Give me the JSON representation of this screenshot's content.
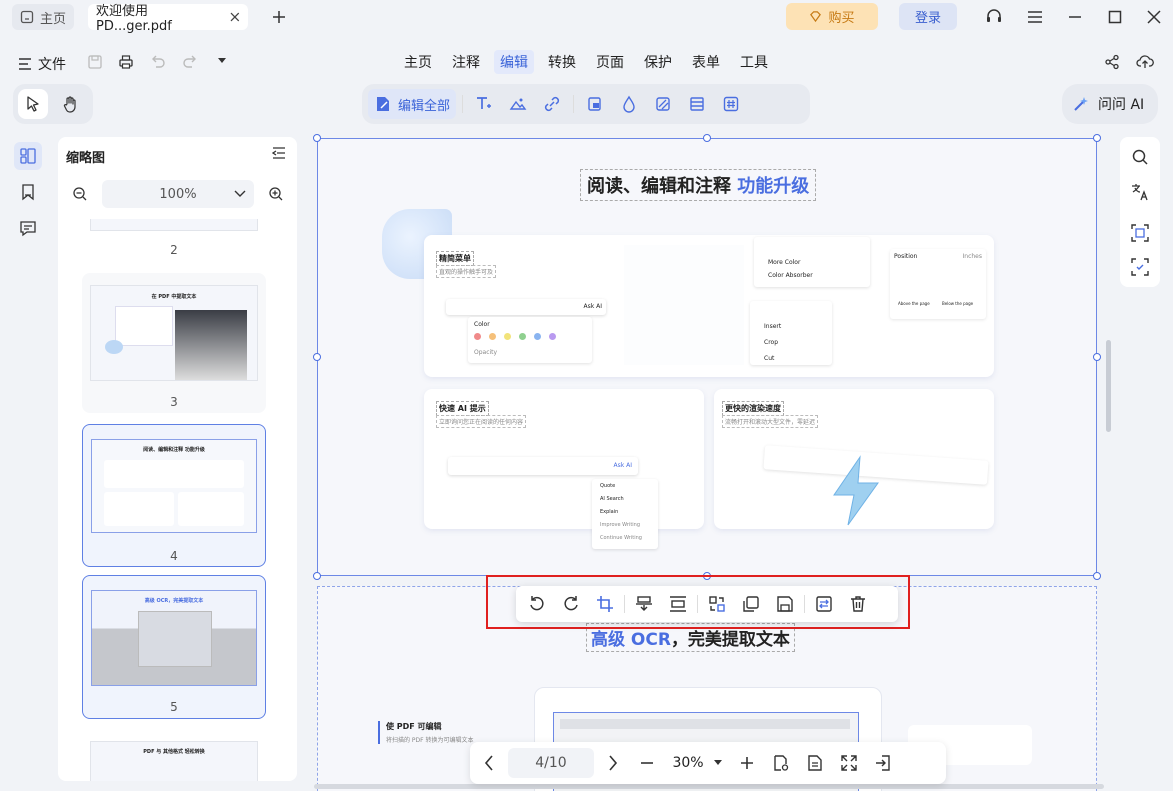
{
  "titlebar": {
    "home_tab": "主页",
    "doc_tab": "欢迎使用 PD...ger.pdf",
    "buy": "购买",
    "login": "登录"
  },
  "menubar": {
    "file": "文件",
    "items": [
      "主页",
      "注释",
      "编辑",
      "转换",
      "页面",
      "保护",
      "表单",
      "工具"
    ],
    "active": "编辑"
  },
  "edit_toolbar": {
    "edit_all": "编辑全部"
  },
  "ask_ai": "问问 AI",
  "thumbnails": {
    "title": "缩略图",
    "zoom": "100%",
    "pages": [
      {
        "num": "2"
      },
      {
        "num": "3",
        "title": "在 PDF 中提取文本"
      },
      {
        "num": "4",
        "title": "阅读、编辑和注释 功能升级"
      },
      {
        "num": "5",
        "title": "高级 OCR，完美提取文本"
      },
      {
        "title": "PDF 与 其他格式 轻松转换"
      }
    ]
  },
  "page": {
    "headline_main": "阅读、编辑和注释",
    "headline_accent": "功能升级",
    "sec1_title": "精简菜单",
    "sec1_sub": "直观的操作触手可及",
    "sec2_title": "快速 AI 提示",
    "sec2_sub": "立即询问您正在阅读的任何内容",
    "sec3_title": "更快的渲染速度",
    "sec3_sub": "流畅打开和滚动大型文件，零延迟",
    "menu_labels": {
      "color": "Color",
      "opacity": "Opacity",
      "more_color": "More Color",
      "color_absorber": "Color Absorber",
      "insert": "Insert",
      "crop": "Crop",
      "cut": "Cut",
      "position": "Position",
      "inches": "Inches",
      "above_page": "Above the page",
      "below_page": "Below the page",
      "ask_ai": "Ask AI",
      "quote": "Quote",
      "ai_search": "AI Search",
      "explain": "Explain",
      "improve": "Improve Writing",
      "continue": "Continue Writing"
    },
    "ocr_headline_accent": "高级 OCR",
    "ocr_headline_main": "，完美提取文本",
    "ocr_sub_title": "使 PDF 可编辑",
    "ocr_sub_text": "将扫描的 PDF 转换为可编辑文本"
  },
  "bottombar": {
    "page": "4/10",
    "zoom": "30%"
  },
  "colors": {
    "accent": "#4a6ee0",
    "selection_red": "#e0201f",
    "buy_bg": "#fde2b5"
  }
}
